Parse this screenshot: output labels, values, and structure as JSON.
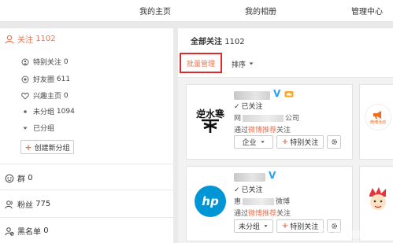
{
  "topnav": {
    "home": "我的主页",
    "album": "我的相册",
    "manage": "管理中心"
  },
  "sidebar": {
    "follow": {
      "label": "关注",
      "count": "1102"
    },
    "sub_items": [
      {
        "label": "特别关注",
        "count": "0"
      },
      {
        "label": "好友圈",
        "count": "611"
      },
      {
        "label": "兴趣主页",
        "count": "0"
      },
      {
        "label": "未分组",
        "count": "1094"
      },
      {
        "label": "已分组",
        "count": ""
      }
    ],
    "create_group": "创建新分组",
    "groups_label": "群",
    "groups_count": "0",
    "fans_label": "粉丝",
    "fans_count": "775",
    "blacklist_label": "黑名单",
    "blacklist_count": "0"
  },
  "main": {
    "title": "全部关注",
    "title_count": "1102",
    "batch_manage": "批量管理",
    "sort": "排序"
  },
  "cards": [
    {
      "status": "已关注",
      "desc_prefix": "网",
      "desc_suffix": "公司",
      "via_prefix": "通过",
      "via_link": "微博推荐",
      "via_suffix": "关注",
      "group_btn": "企业",
      "special_btn": "特别关注",
      "avatar_text": "逆水寒"
    },
    {
      "status": "已关注",
      "desc_prefix": "惠",
      "desc_suffix": "微博",
      "via_prefix": "通过",
      "via_link": "微博推荐",
      "via_suffix": "关注",
      "group_btn": "未分组",
      "special_btn": "特别关注",
      "avatar_text": "hp"
    }
  ],
  "right_partial": {
    "first_label": "微博活动"
  },
  "colors": {
    "accent": "#eb7350",
    "highlight_box": "#e0292b",
    "verified": "#2aa0f0",
    "hp_blue": "#0096d6"
  }
}
